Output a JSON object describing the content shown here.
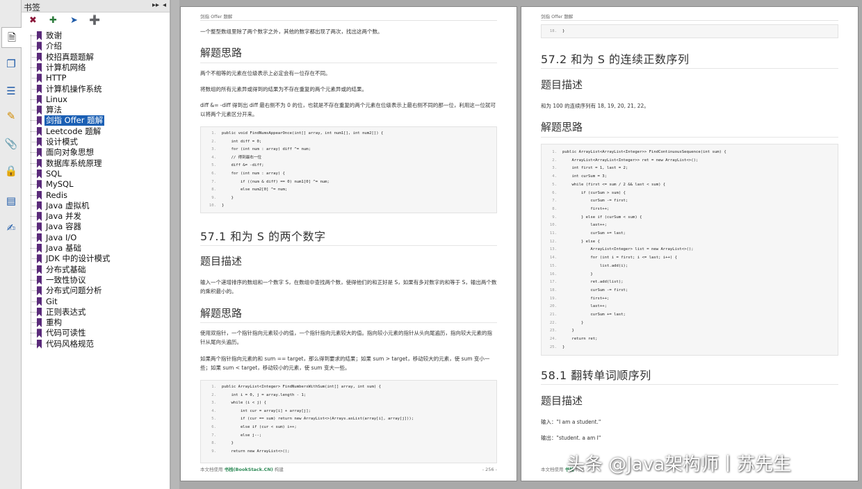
{
  "panel": {
    "title": "书签",
    "collapse_label": "▸▸",
    "close_label": "◂"
  },
  "icons": [
    "page-thumbnail-icon",
    "layers-icon",
    "layers-stack-icon",
    "comments-icon",
    "attachment-icon",
    "lock-icon",
    "fields-icon",
    "signature-icon"
  ],
  "toolbar_icons": [
    "delete-bookmark-icon",
    "add-bookmark-icon",
    "expand-bookmark-icon",
    "new-bookmark-icon"
  ],
  "bookmarks": [
    {
      "label": "致谢",
      "selected": false
    },
    {
      "label": "介绍",
      "selected": false
    },
    {
      "label": "校招真题题解",
      "selected": false
    },
    {
      "label": "计算机网络",
      "selected": false
    },
    {
      "label": "HTTP",
      "selected": false
    },
    {
      "label": "计算机操作系统",
      "selected": false
    },
    {
      "label": "Linux",
      "selected": false
    },
    {
      "label": "算法",
      "selected": false
    },
    {
      "label": "剑指 Offer 题解",
      "selected": true
    },
    {
      "label": "Leetcode 题解",
      "selected": false
    },
    {
      "label": "设计模式",
      "selected": false
    },
    {
      "label": "面向对象思想",
      "selected": false
    },
    {
      "label": "数据库系统原理",
      "selected": false
    },
    {
      "label": "SQL",
      "selected": false
    },
    {
      "label": "MySQL",
      "selected": false
    },
    {
      "label": "Redis",
      "selected": false
    },
    {
      "label": "Java 虚拟机",
      "selected": false
    },
    {
      "label": "Java 并发",
      "selected": false
    },
    {
      "label": "Java 容器",
      "selected": false
    },
    {
      "label": "Java I/O",
      "selected": false
    },
    {
      "label": "Java 基础",
      "selected": false
    },
    {
      "label": "JDK 中的设计模式",
      "selected": false
    },
    {
      "label": "分布式基础",
      "selected": false
    },
    {
      "label": "一致性协议",
      "selected": false
    },
    {
      "label": "分布式问题分析",
      "selected": false
    },
    {
      "label": "Git",
      "selected": false
    },
    {
      "label": "正则表达式",
      "selected": false
    },
    {
      "label": "重构",
      "selected": false
    },
    {
      "label": "代码可读性",
      "selected": false
    },
    {
      "label": "代码风格规范",
      "selected": false
    }
  ],
  "page1": {
    "running_head": "剑指 Offer 题解",
    "intro": "一个整型数组里除了两个数字之外，其他的数字都出现了两次，找出这两个数。",
    "h_solution1": "解题思路",
    "p1": "两个不相等的元素在位级表示上必定会有一位存在不同。",
    "p2": "将数组的所有元素异或得到的结果为不存在重复的两个元素异或的结果。",
    "p3": "diff &= -diff 得到出 diff 最右侧不为 0 的位，也就是不存在重复的两个元素在位级表示上最右侧不同的那一位，利用这一位就可以将两个元素区分开来。",
    "code1": [
      "public void FindNumsAppearOnce(int[] array, int num1[], int num2[]) {",
      "    int diff = 0;",
      "    for (int num : array) diff ^= num;",
      "    // 得到最右一位",
      "    diff &= -diff;",
      "    for (int num : array) {",
      "        if ((num & diff) == 0) num1[0] ^= num;",
      "        else num2[0] ^= num;",
      "    }",
      "}"
    ],
    "h_571": "57.1 和为 S 的两个数字",
    "h_desc": "题目描述",
    "desc": "输入一个递增排序的数组和一个数字 S，在数组中查找两个数，使得他们的和正好是 S，如果有多对数字的和等于 S，输出两个数的乘积最小的。",
    "h_solution2": "解题思路",
    "p4": "使用双指针，一个指针指向元素较小的值，一个指针指向元素较大的值。指向较小元素的指针从头向尾遍历，指向较大元素的指针从尾向头遍历。",
    "p5": "如果两个指针指向元素的和 sum == target，那么得到要求的结果；如果 sum > target，移动较大的元素，使 sum 变小一些；如果 sum < target，移动较小的元素，使 sum 变大一些。",
    "code2": [
      "public ArrayList<Integer> FindNumbersWithSum(int[] array, int sum) {",
      "    int i = 0, j = array.length - 1;",
      "    while (i < j) {",
      "        int cur = array[i] + array[j];",
      "        if (cur == sum) return new ArrayList<>(Arrays.asList(array[i], array[j]));",
      "        else if (cur < sum) i++;",
      "        else j--;",
      "    }",
      "    return new ArrayList<>();"
    ],
    "footer_prefix": "本文档使用",
    "footer_brand": "书栈(BookStack.CN)",
    "footer_suffix": "构建",
    "page_number": "- 256 -"
  },
  "page2": {
    "running_head": "剑指 Offer 题解",
    "code_tail": "}",
    "h_572": "57.2 和为 S 的连续正数序列",
    "h_desc": "题目描述",
    "desc": "和为 100 的连续序列有 18, 19, 20, 21, 22。",
    "h_solution": "解题思路",
    "code": [
      "public ArrayList<ArrayList<Integer>> FindContinuousSequence(int sum) {",
      "    ArrayList<ArrayList<Integer>> ret = new ArrayList<>();",
      "    int first = 1, last = 2;",
      "    int curSum = 3;",
      "    while (first <= sum / 2 && last < sum) {",
      "        if (curSum > sum) {",
      "            curSum -= first;",
      "            first++;",
      "        } else if (curSum < sum) {",
      "            last++;",
      "            curSum += last;",
      "        } else {",
      "            ArrayList<Integer> list = new ArrayList<>();",
      "            for (int i = first; i <= last; i++) {",
      "                list.add(i);",
      "            }",
      "            ret.add(list);",
      "            curSum -= first;",
      "            first++;",
      "            last++;",
      "            curSum += last;",
      "        }",
      "    }",
      "    return ret;",
      "}"
    ],
    "h_581": "58.1 翻转单词顺序列",
    "h_desc2": "题目描述",
    "input": "输入：\"I am a student.\"",
    "output": "输出：\"student. a am I\"",
    "footer_prefix": "本文档使用",
    "footer_brand": "书栈",
    "footer_suffix": "构建"
  },
  "watermark": "头条 @Java架构师丨苏先生"
}
